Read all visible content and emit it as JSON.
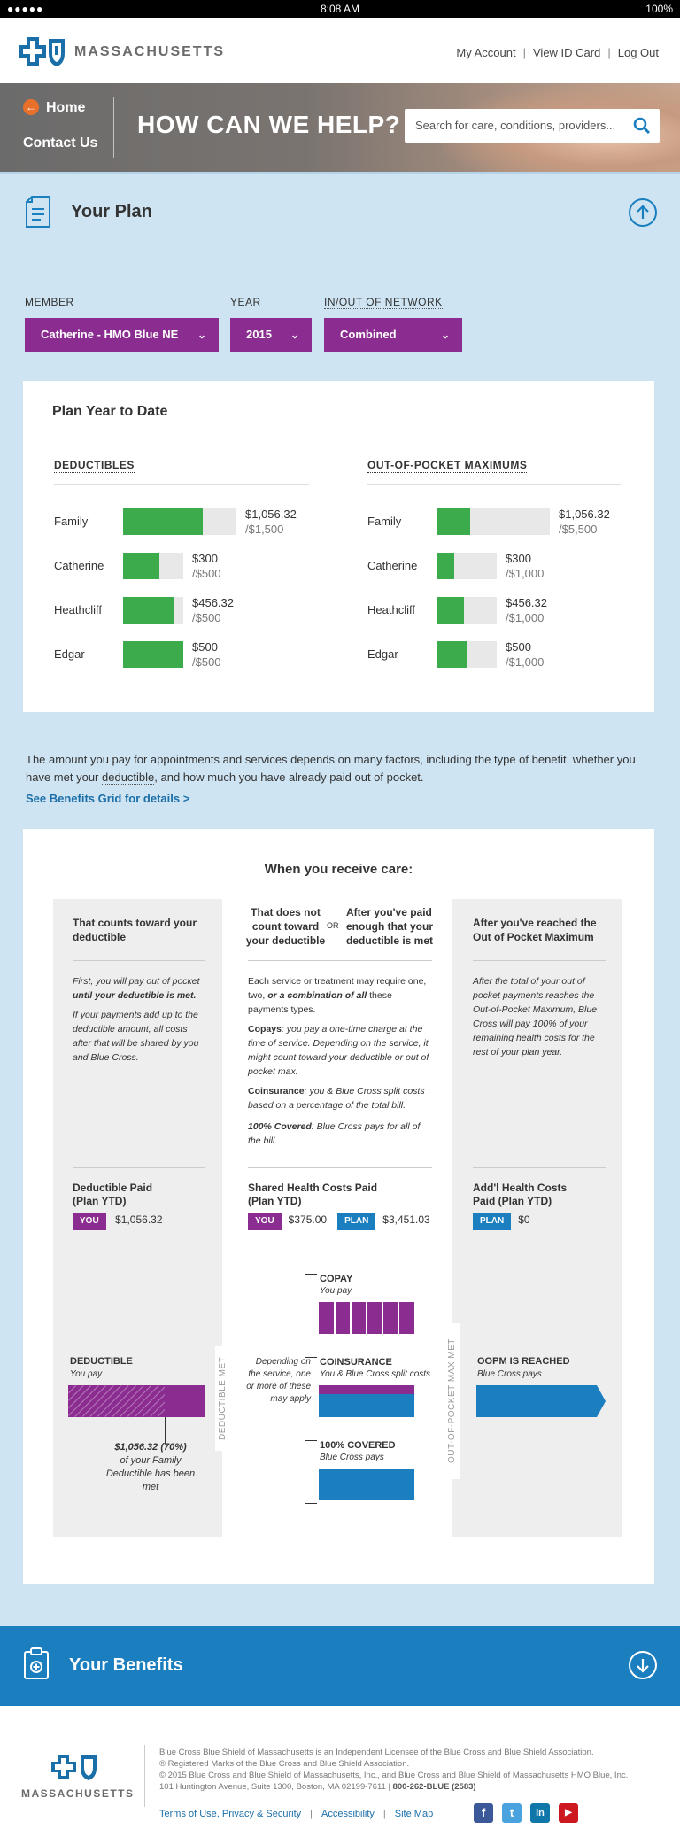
{
  "status_bar": {
    "signal": "●●●●● ",
    "time": "8:08 AM",
    "battery": "100%"
  },
  "header": {
    "brand": "MASSACHUSETTS",
    "links": [
      "My Account",
      "View ID Card",
      "Log Out"
    ],
    "separator": "|"
  },
  "hero": {
    "nav": [
      {
        "label": "Home"
      },
      {
        "label": "Contact Us"
      }
    ],
    "title": "HOW CAN WE HELP?",
    "search_placeholder": "Search for care, conditions, providers..."
  },
  "your_plan": {
    "title": "Your Plan",
    "filters": {
      "member": {
        "label": "MEMBER",
        "value": "Catherine - HMO Blue NE"
      },
      "year": {
        "label": "YEAR",
        "value": "2015"
      },
      "network": {
        "label": "IN/OUT OF NETWORK",
        "value": "Combined"
      }
    }
  },
  "plan_ytd": {
    "title": "Plan Year to Date",
    "deductibles": {
      "heading": "DEDUCTIBLES",
      "rows": [
        {
          "name": "Family",
          "paid": "$1,056.32",
          "total": "/$1,500",
          "fraction": 0.7
        },
        {
          "name": "Catherine",
          "paid": "$300",
          "total": "/$500",
          "fraction": 0.6
        },
        {
          "name": "Heathcliff",
          "paid": "$456.32",
          "total": "/$500",
          "fraction": 0.85
        },
        {
          "name": "Edgar",
          "paid": "$500",
          "total": "/$500",
          "fraction": 1.0
        }
      ]
    },
    "oop": {
      "heading": "OUT-OF-POCKET MAXIMUMS",
      "rows": [
        {
          "name": "Family",
          "paid": "$1,056.32",
          "total": "/$5,500",
          "fraction": 0.3
        },
        {
          "name": "Catherine",
          "paid": "$300",
          "total": "/$1,000",
          "fraction": 0.3
        },
        {
          "name": "Heathcliff",
          "paid": "$456.32",
          "total": "/$1,000",
          "fraction": 0.46
        },
        {
          "name": "Edgar",
          "paid": "$500",
          "total": "/$1,000",
          "fraction": 0.5
        }
      ]
    }
  },
  "info": {
    "text_1": "The amount you pay for appointments and services depends on many factors, including the type of benefit, whether you have met your ",
    "text_link": "deductible",
    "text_2": ", and how much you have already paid out of pocket.",
    "link": "See Benefits Grid for details >"
  },
  "care": {
    "title": "When you receive care:",
    "col1": {
      "head": "That counts toward your deductible",
      "p1a": "First, you will pay out of pocket ",
      "p1b": "until your deductible is met.",
      "p2": "If your payments add up to the deductible amount, all costs after that will be shared by you and Blue Cross.",
      "paid_head": "Deductible Paid (Plan YTD)",
      "you_tag": "YOU",
      "you_amt": "$1,056.32"
    },
    "col2": {
      "head_a": "That does not count toward your deductible",
      "or": "OR",
      "head_b": "After you've paid enough that your deductible is met",
      "p1a": "Each service or treatment may require one, two, ",
      "p1b": "or a combination of all",
      "p1c": " these payments types.",
      "copays_term": "Copays",
      "copays_text": ": you pay a one-time charge at the time of service. Depending on the service, it might count toward your deductible or out of pocket max.",
      "coins_term": "Coinsurance",
      "coins_text": ": you & Blue Cross split costs based on a percentage of the total bill.",
      "covered_term": "100% Covered",
      "covered_text": ": Blue Cross pays for all of the bill.",
      "paid_head": "Shared Health Costs Paid (Plan YTD)",
      "you_tag": "YOU",
      "you_amt": "$375.00",
      "plan_tag": "PLAN",
      "plan_amt": "$3,451.03"
    },
    "col3": {
      "head": "After you've reached the Out of Pocket Maximum",
      "p1": "After the total of your out of pocket payments reaches the Out-of-Pocket Maximum, Blue Cross will pay 100% of your remaining health costs for the rest of your plan year.",
      "paid_head": "Add'l Health Costs Paid (Plan YTD)",
      "plan_tag": "PLAN",
      "plan_amt": "$0"
    },
    "graphic": {
      "deductible_label": "DEDUCTIBLE",
      "deductible_sub": "You pay",
      "deductible_met": "DEDUCTIBLE MET",
      "deductible_note_bold": "$1,056.32 (70%)",
      "deductible_note": "of your Family Deductible has been met",
      "deductible_progress": 0.7,
      "depending": "Depending on the service, one or more of these may apply",
      "copay_label": "COPAY",
      "copay_sub": "You pay",
      "coins_label": "COINSURANCE",
      "coins_sub": "You & Blue Cross split costs",
      "covered_label": "100% COVERED",
      "covered_sub": "Blue Cross pays",
      "oop_met": "OUT-OF-POCKET MAX MET",
      "oopm_label": "OOPM IS REACHED",
      "oopm_sub": "Blue Cross pays"
    }
  },
  "benefits": {
    "title": "Your Benefits"
  },
  "footer": {
    "brand": "MASSACHUSETTS",
    "line1": "Blue Cross Blue Shield of Massachusetts is an Independent Licensee of the Blue Cross and Blue Shield Association.",
    "line2": "® Registered Marks of the Blue Cross and Blue Shield Association.",
    "line3": "© 2015 Blue Cross and Blue Shield of Massachusetts, Inc., and Blue Cross and Blue Shield of Massachusetts HMO Blue, Inc.",
    "line4": "101 Huntington Avenue, Suite 1300, Boston, MA 02199-7611 | ",
    "phone": "800-262-BLUE (2583)",
    "links": [
      "Terms of Use, Privacy & Security",
      "Accessibility",
      "Site Map"
    ],
    "social": [
      "f",
      "t",
      "in",
      "▶"
    ]
  },
  "colors": {
    "purple": "#8b2d90",
    "blue": "#1b7fbf",
    "green": "#3bab4b",
    "orange": "#e8702a"
  }
}
